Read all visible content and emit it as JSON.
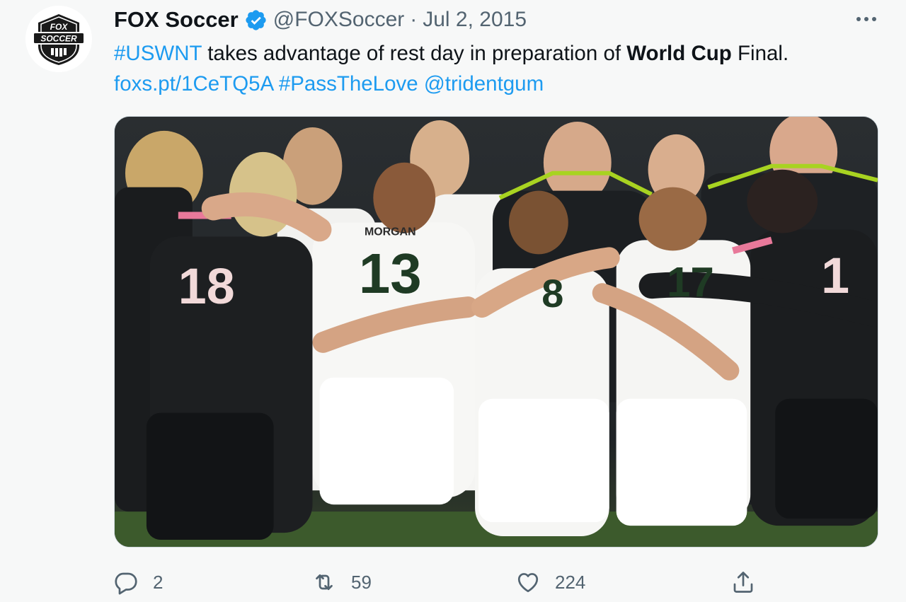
{
  "tweet": {
    "author": {
      "display_name": "FOX Soccer",
      "handle": "@FOXSoccer",
      "avatar_text_top": "FOX",
      "avatar_text_bottom": "SOCCER",
      "verified": true
    },
    "separator": "·",
    "date": "Jul 2, 2015",
    "text": {
      "hashtag_uswnt": "#USWNT",
      "part1": " takes advantage of rest day in preparation of ",
      "world_cup": "World Cup",
      "part2": " Final.",
      "link": "foxs.pt/1CeTQ5A",
      "hashtag_passthelove": "#PassTheLove",
      "mention": "@tridentgum"
    },
    "media": {
      "jersey_morgan_name": "MORGAN",
      "jersey_18": "18",
      "jersey_13": "13",
      "jersey_1": "1",
      "jersey_8": "8",
      "jersey_17": "17"
    },
    "actions": {
      "replies": "2",
      "retweets": "59",
      "likes": "224"
    }
  },
  "colors": {
    "link": "#1d9bf0",
    "secondary_text": "#536471",
    "verified": "#1d9bf0",
    "background": "#f7f8f8"
  },
  "icons": [
    "fox-soccer-logo",
    "verified-badge-icon",
    "more-icon",
    "reply-icon",
    "retweet-icon",
    "like-icon",
    "share-icon"
  ]
}
